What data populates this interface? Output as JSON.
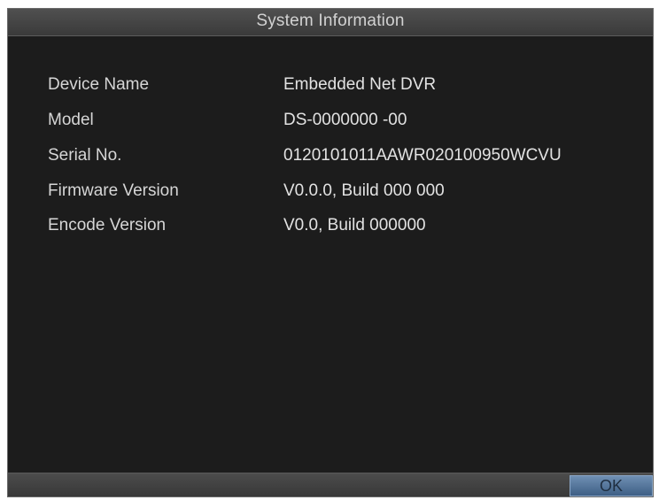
{
  "window": {
    "title": "System Information"
  },
  "info": {
    "rows": [
      {
        "label": "Device Name",
        "value": "Embedded Net DVR"
      },
      {
        "label": "Model",
        "value": "DS-0000000 -00"
      },
      {
        "label": "Serial No.",
        "value": "0120101011AAWR020100950WCVU"
      },
      {
        "label": "Firmware Version",
        "value": "V0.0.0, Build 000 000"
      },
      {
        "label": "Encode Version",
        "value": "V0.0, Build 000000"
      }
    ]
  },
  "footer": {
    "ok_label": "OK"
  },
  "colors": {
    "background": "#1d1d1d",
    "titlebar": "#464646",
    "text": "#d6d6d6",
    "ok_button": "#5a7ca3"
  }
}
